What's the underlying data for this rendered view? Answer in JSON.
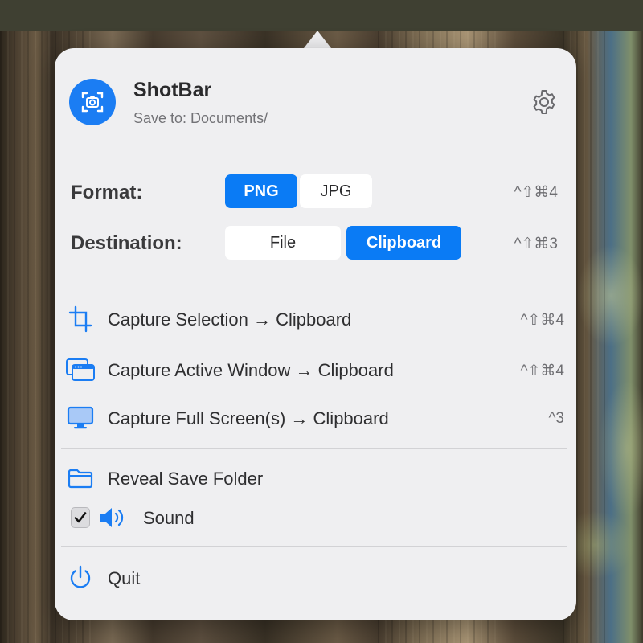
{
  "app": {
    "title": "ShotBar",
    "subtitle": "Save to: Documents/",
    "icon": "camera-viewfinder-icon",
    "settings_icon": "gear-icon"
  },
  "format": {
    "label": "Format:",
    "options": [
      "PNG",
      "JPG"
    ],
    "selected": "PNG",
    "shortcut": "^⇧⌘4"
  },
  "destination": {
    "label": "Destination:",
    "options": [
      "File",
      "Clipboard"
    ],
    "selected": "Clipboard",
    "shortcut": "^⇧⌘3"
  },
  "menu": {
    "items": [
      {
        "label": "Capture Selection → Clipboard",
        "shortcut": "^⇧⌘4",
        "icon": "crop-icon"
      },
      {
        "label": "Capture Active Window → Clipboard",
        "shortcut": "^⇧⌘4",
        "icon": "windows-icon"
      },
      {
        "label": "Capture Full Screen(s) → Clipboard",
        "shortcut": "^3",
        "icon": "display-icon"
      }
    ],
    "reveal": {
      "label": "Reveal Save Folder",
      "icon": "folder-icon"
    },
    "sound": {
      "label": "Sound",
      "checked": true,
      "icon": "speaker-icon"
    },
    "quit": {
      "label": "Quit",
      "icon": "power-icon"
    }
  },
  "colors": {
    "accent": "#0a7bf5",
    "panel": "#efeff1",
    "icon_blue": "#1b7df3"
  }
}
